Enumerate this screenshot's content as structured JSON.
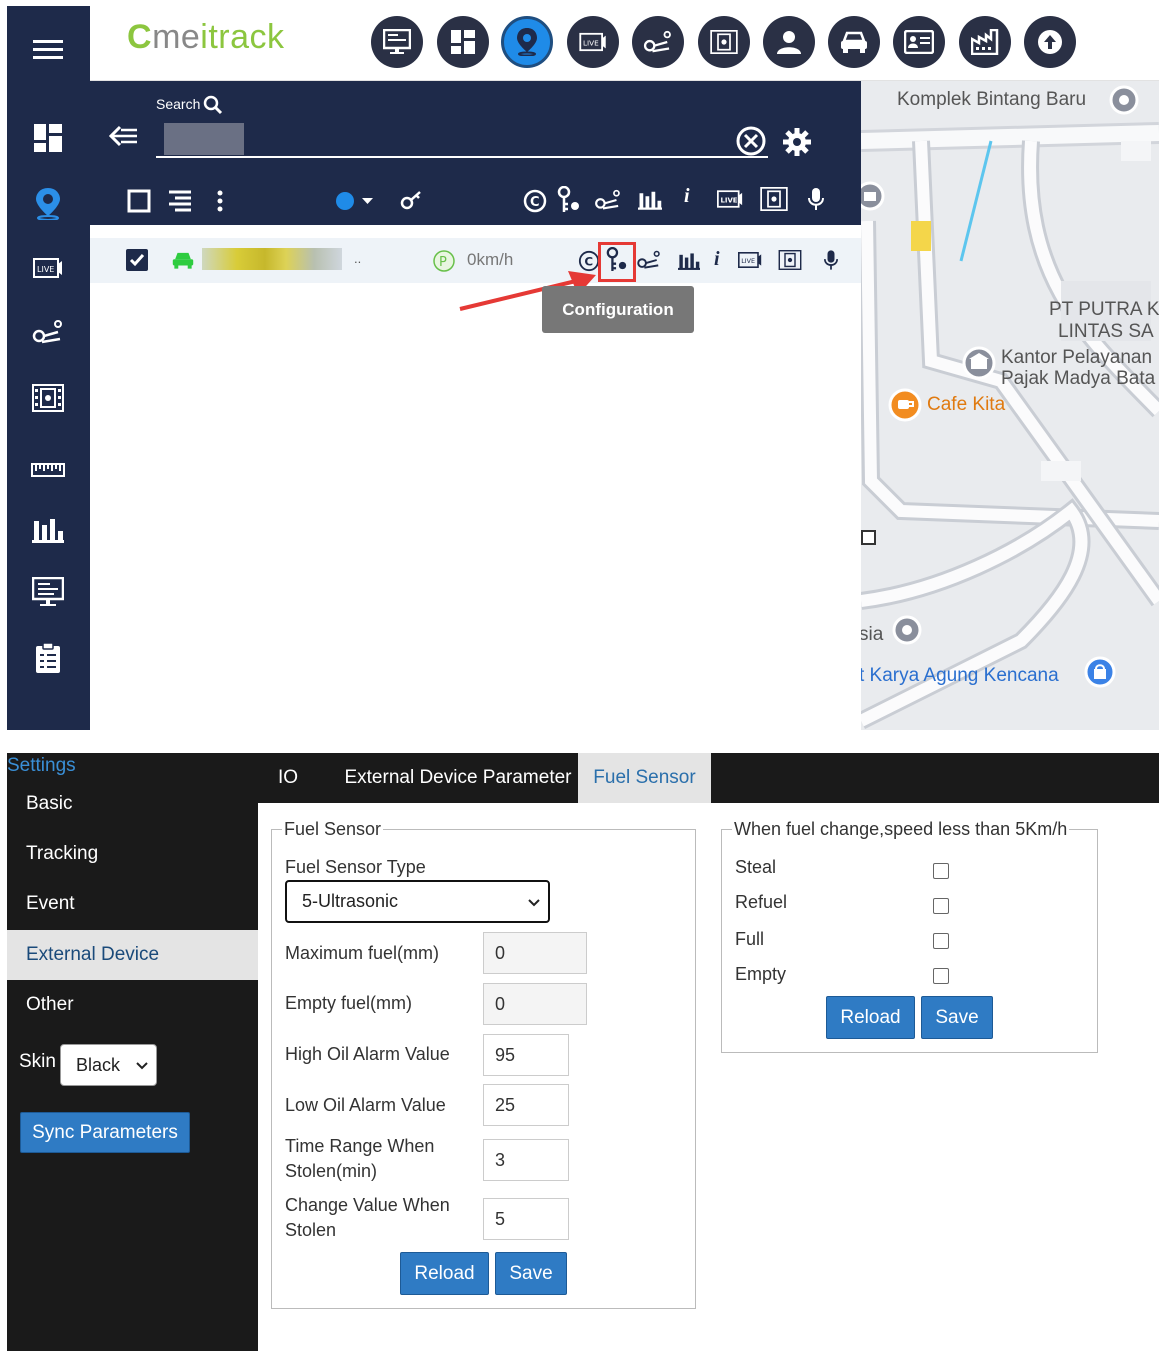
{
  "header": {
    "logo_text_prefix": "me",
    "logo_text_i": "i",
    "logo_text_track": "track",
    "logo_c": "C",
    "icons": [
      "monitor-icon",
      "dashboard-icon",
      "location-pin-icon",
      "live-video-icon",
      "route-icon",
      "film-icon",
      "person-icon",
      "car-icon",
      "id-card-icon",
      "factory-icon",
      "upload-icon"
    ],
    "active_icon": "location-pin-icon"
  },
  "left_nav": [
    "menu-icon",
    "dashboard-icon",
    "location-pin-icon",
    "live-video-icon",
    "route-icon",
    "film-icon",
    "ruler-icon",
    "bar-chart-icon",
    "monitor-icon",
    "clipboard-icon"
  ],
  "search": {
    "label": "Search"
  },
  "device_row": {
    "speed": "0km/h",
    "ellipsis": ".."
  },
  "tooltip": {
    "text": "Configuration"
  },
  "map": {
    "labels": {
      "komplek": "Komplek Bintang Baru",
      "pt_putra_1": "PT PUTRA K",
      "pt_putra_2": "LINTAS SA",
      "kantor_1": "Kantor Pelayanan",
      "kantor_2": "Pajak Madya Bata",
      "cafe": "Cafe Kita",
      "sia": "sia",
      "karya": "t Karya Agung Kencana"
    }
  },
  "settings": {
    "title": "Settings",
    "items": [
      "Basic",
      "Tracking",
      "Event",
      "External Device",
      "Other"
    ],
    "active_item": "External Device",
    "skin_label": "Skin",
    "skin_value": "Black",
    "sync_button": "Sync Parameters"
  },
  "tabs": [
    "IO",
    "External Device Parameter",
    "Fuel Sensor"
  ],
  "active_tab": "Fuel Sensor",
  "fuel_sensor": {
    "legend": "Fuel Sensor",
    "type_label": "Fuel Sensor Type",
    "type_value": "5-Ultrasonic",
    "max_fuel_label": "Maximum fuel(mm)",
    "max_fuel_value": "0",
    "empty_fuel_label": "Empty fuel(mm)",
    "empty_fuel_value": "0",
    "high_alarm_label": "High Oil Alarm Value",
    "high_alarm_value": "95",
    "low_alarm_label": "Low Oil Alarm Value",
    "low_alarm_value": "25",
    "time_range_label_1": "Time Range When",
    "time_range_label_2": "Stolen(min)",
    "time_range_value": "3",
    "change_value_label_1": "Change Value When",
    "change_value_label_2": "Stolen",
    "change_value_value": "5",
    "reload": "Reload",
    "save": "Save"
  },
  "fuel_change": {
    "legend": "When fuel change,speed less than 5Km/h",
    "steal": "Steal",
    "refuel": "Refuel",
    "full": "Full",
    "empty": "Empty",
    "reload": "Reload",
    "save": "Save"
  }
}
